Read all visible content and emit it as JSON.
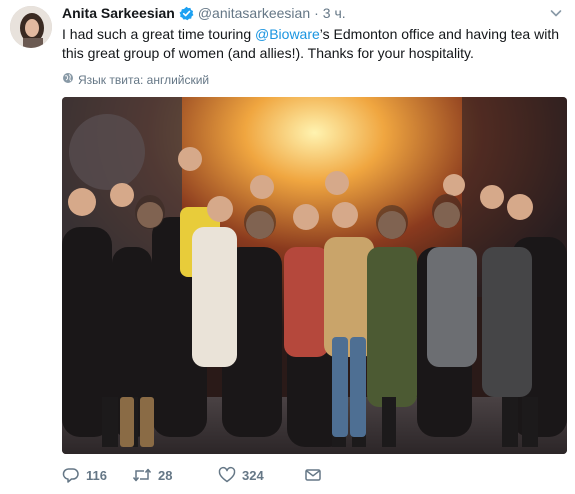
{
  "tweet": {
    "display_name": "Anita Sarkeesian",
    "handle": "@anitasarkeesian",
    "separator": "·",
    "time": "3 ч.",
    "text_before": "I had such a great time touring ",
    "mention": "@Bioware",
    "text_after": "’s Edmonton office and having tea with this great group of women (and allies!). Thanks for your hospitality.",
    "translate_label": "Язык твита: английский",
    "reply_count": "116",
    "retweet_count": "28",
    "like_count": "324"
  },
  "colors": {
    "link": "#1b95e0",
    "muted": "#657786",
    "text": "#14171a"
  },
  "icons": {
    "verified": "verified-badge-icon",
    "caret": "chevron-down-icon",
    "globe": "globe-icon",
    "reply": "reply-icon",
    "retweet": "retweet-icon",
    "like": "heart-icon",
    "dm": "envelope-icon"
  }
}
